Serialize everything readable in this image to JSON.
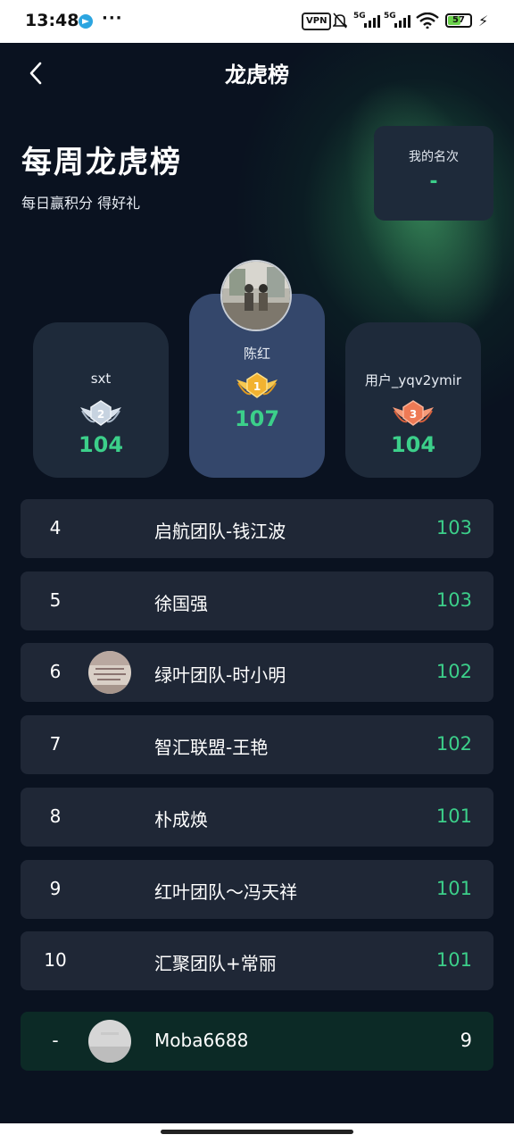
{
  "status_bar": {
    "time": "13:48",
    "vpn": "VPN",
    "signal1": "5G",
    "signal2": "5G",
    "battery": "57"
  },
  "nav": {
    "title": "龙虎榜"
  },
  "hero": {
    "title": "每周龙虎榜",
    "subtitle": "每日赢积分 得好礼"
  },
  "my_rank": {
    "label": "我的名次",
    "value": "-"
  },
  "podium": {
    "first": {
      "name": "陈红",
      "score": "107",
      "medal_rank": "1"
    },
    "second": {
      "name": "sxt",
      "score": "104",
      "medal_rank": "2"
    },
    "third": {
      "name": "用户_yqv2ymir",
      "score": "104",
      "medal_rank": "3"
    }
  },
  "ranking": [
    {
      "rank": "4",
      "name": "启航团队-钱江波",
      "score": "103",
      "has_avatar": false
    },
    {
      "rank": "5",
      "name": "徐国强",
      "score": "103",
      "has_avatar": false
    },
    {
      "rank": "6",
      "name": "绿叶团队-时小明",
      "score": "102",
      "has_avatar": true
    },
    {
      "rank": "7",
      "name": "智汇联盟-王艳",
      "score": "102",
      "has_avatar": false
    },
    {
      "rank": "8",
      "name": "朴成焕",
      "score": "101",
      "has_avatar": false
    },
    {
      "rank": "9",
      "name": "红叶团队～冯天祥",
      "score": "101",
      "has_avatar": false
    },
    {
      "rank": "10",
      "name": "汇聚团队+常丽",
      "score": "101",
      "has_avatar": false
    }
  ],
  "me": {
    "rank": "-",
    "name": "Moba6688",
    "score": "9"
  },
  "colors": {
    "background": "#0a1220",
    "card": "#1f2736",
    "podium_center": "#34476b",
    "score_green": "#3ccf8a",
    "my_row": "#0c2a26",
    "gold": "#f2b230",
    "silver": "#c7d3e0",
    "bronze": "#ee7a55"
  },
  "icons": [
    "back-arrow-icon",
    "gold-medal-icon",
    "silver-medal-icon",
    "bronze-medal-icon",
    "telegram-icon",
    "wifi-icon",
    "battery-icon"
  ]
}
